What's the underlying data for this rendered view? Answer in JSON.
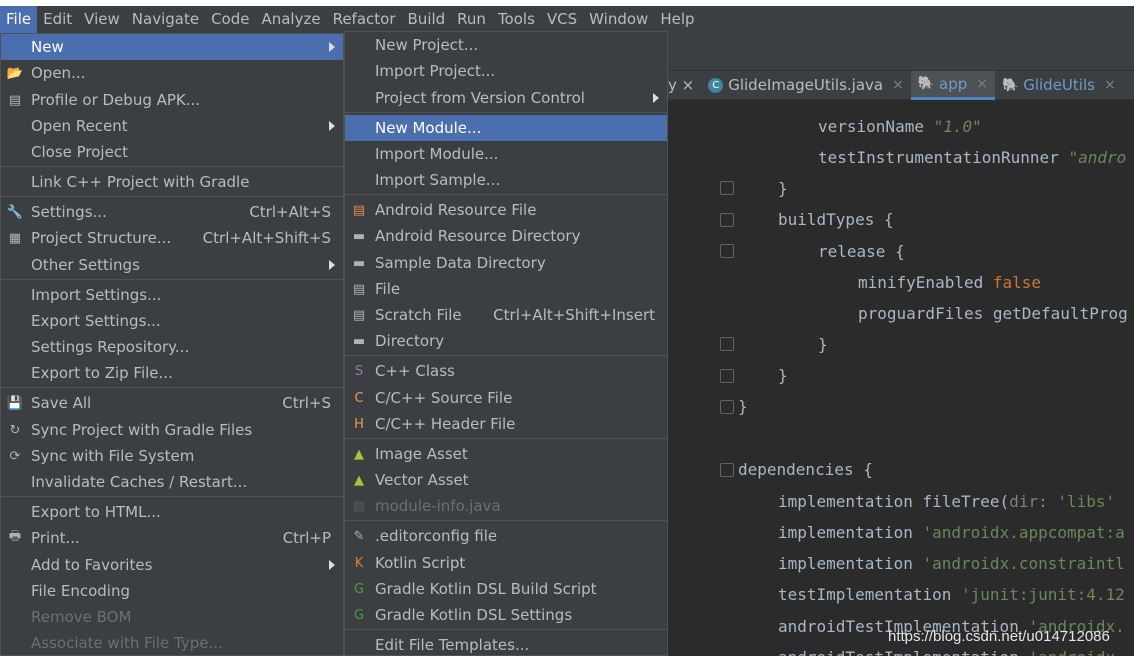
{
  "menubar": [
    "File",
    "Edit",
    "View",
    "Navigate",
    "Code",
    "Analyze",
    "Refactor",
    "Build",
    "Run",
    "Tools",
    "VCS",
    "Window",
    "Help"
  ],
  "tabs": [
    {
      "label": "GlideImageUtils.java",
      "icon": "class-icon",
      "close": "×"
    },
    {
      "label": "app",
      "icon": "gradle-icon",
      "close": "×"
    },
    {
      "label": "GlideUtils",
      "icon": "gradle-icon",
      "close": "×"
    }
  ],
  "tab_fragment": "y ×",
  "file_menu": [
    {
      "label": "New",
      "arrow": true,
      "selected": true
    },
    {
      "label": "Open...",
      "icon": "folder-open-icon"
    },
    {
      "label": "Profile or Debug APK...",
      "icon": "apk-icon"
    },
    {
      "label": "Open Recent",
      "arrow": true
    },
    {
      "label": "Close Project"
    },
    {
      "label": "Link C++ Project with Gradle"
    },
    {
      "label": "Settings...",
      "shortcut": "Ctrl+Alt+S",
      "icon": "wrench-icon"
    },
    {
      "label": "Project Structure...",
      "shortcut": "Ctrl+Alt+Shift+S",
      "icon": "project-structure-icon"
    },
    {
      "label": "Other Settings",
      "arrow": true
    },
    {
      "label": "Import Settings..."
    },
    {
      "label": "Export Settings..."
    },
    {
      "label": "Settings Repository..."
    },
    {
      "label": "Export to Zip File..."
    },
    {
      "label": "Save All",
      "shortcut": "Ctrl+S",
      "icon": "save-icon"
    },
    {
      "label": "Sync Project with Gradle Files",
      "icon": "gradle-sync-icon"
    },
    {
      "label": "Sync with File System",
      "icon": "refresh-icon"
    },
    {
      "label": "Invalidate Caches / Restart..."
    },
    {
      "label": "Export to HTML..."
    },
    {
      "label": "Print...",
      "shortcut": "Ctrl+P",
      "icon": "print-icon"
    },
    {
      "label": "Add to Favorites",
      "arrow": true
    },
    {
      "label": "File Encoding"
    },
    {
      "label": "Remove BOM",
      "disabled": true
    },
    {
      "label": "Associate with File Type...",
      "disabled": true
    }
  ],
  "new_menu": [
    {
      "label": "New Project..."
    },
    {
      "label": "Import Project..."
    },
    {
      "label": "Project from Version Control",
      "arrow": true
    },
    {
      "label": "New Module...",
      "selected": true
    },
    {
      "label": "Import Module..."
    },
    {
      "label": "Import Sample..."
    },
    {
      "label": "Android Resource File",
      "icon": "resource-file-icon"
    },
    {
      "label": "Android Resource Directory",
      "icon": "folder-icon"
    },
    {
      "label": "Sample Data Directory",
      "icon": "folder-icon"
    },
    {
      "label": "File",
      "icon": "file-icon"
    },
    {
      "label": "Scratch File",
      "shortcut": "Ctrl+Alt+Shift+Insert",
      "icon": "scratch-file-icon"
    },
    {
      "label": "Directory",
      "icon": "folder-icon"
    },
    {
      "label": "C++ Class",
      "icon": "cpp-class-icon"
    },
    {
      "label": "C/C++ Source File",
      "icon": "cpp-source-icon"
    },
    {
      "label": "C/C++ Header File",
      "icon": "cpp-header-icon"
    },
    {
      "label": "Image Asset",
      "icon": "android-icon"
    },
    {
      "label": "Vector Asset",
      "icon": "android-icon"
    },
    {
      "label": "module-info.java",
      "disabled": true,
      "icon": "module-info-icon"
    },
    {
      "label": ".editorconfig file",
      "icon": "editorconfig-icon"
    },
    {
      "label": "Kotlin Script",
      "icon": "kotlin-icon"
    },
    {
      "label": "Gradle Kotlin DSL Build Script",
      "icon": "gradle-g-icon"
    },
    {
      "label": "Gradle Kotlin DSL Settings",
      "icon": "gradle-g-icon"
    },
    {
      "label": "Edit File Templates..."
    }
  ],
  "code": {
    "l1": "versionName ",
    "l1s": "\"1.0\"",
    "l2": "testInstrumentationRunner ",
    "l2s": "\"andro",
    "l3": "}",
    "l4": "buildTypes {",
    "l5": "release {",
    "l6": "minifyEnabled ",
    "l6k": "false",
    "l7": "proguardFiles getDefaultProg",
    "l8": "}",
    "l9": "}",
    "l10": "}",
    "l11": "dependencies {",
    "l12a": "implementation fileTree(",
    "l12p": "dir: ",
    "l12s": "'libs'",
    "l13a": "implementation ",
    "l13s": "'androidx.appcompat:a",
    "l14a": "implementation ",
    "l14s": "'androidx.constraintl",
    "l15a": "testImplementation ",
    "l15s": "'junit:junit:4.12",
    "l16a": "androidTestImplementation ",
    "l16s": "'androidx.",
    "l17a": "androidTestImplementation ",
    "l17s": "'androidx."
  },
  "watermark": "https://blog.csdn.net/u014712086"
}
